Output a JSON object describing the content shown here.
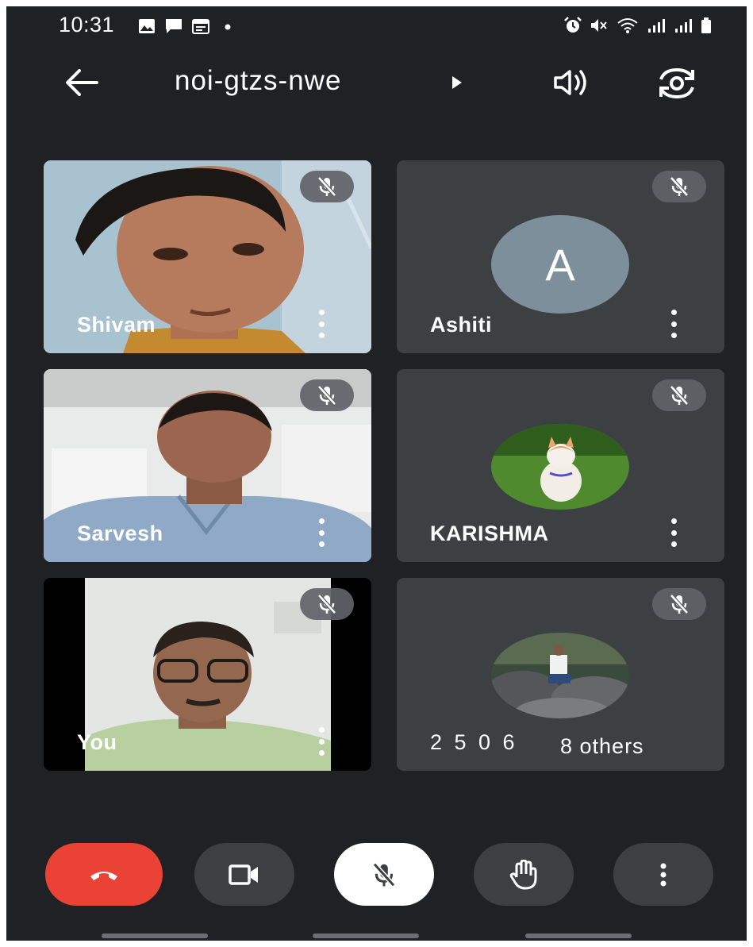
{
  "status_bar": {
    "time": "10:31",
    "left_icons": [
      "gallery-icon",
      "message-icon",
      "calendar-icon",
      "dot-icon"
    ],
    "right_icons": [
      "alarm-icon",
      "mute-icon",
      "wifi-icon",
      "signal-icon",
      "signal-icon",
      "battery-icon"
    ]
  },
  "top_bar": {
    "meeting_code": "noi-gtzs-nwe",
    "back_icon": "arrow-left-icon",
    "title_arrow_icon": "triangle-right-icon",
    "speaker_icon": "speaker-icon",
    "switch_camera_icon": "camera-flip-icon"
  },
  "participants": [
    {
      "name": "Shivam",
      "muted": true,
      "type": "video"
    },
    {
      "name": "Ashiti",
      "muted": true,
      "type": "avatar",
      "avatar_letter": "A"
    },
    {
      "name": "Sarvesh",
      "muted": true,
      "type": "video"
    },
    {
      "name": "KARISHMA",
      "muted": true,
      "type": "avatar-photo"
    },
    {
      "name": "You",
      "muted": true,
      "type": "video"
    },
    {
      "name": "2 5 0 6",
      "muted": true,
      "type": "avatar-photo",
      "overlay_label": "8 others"
    }
  ],
  "controls": {
    "end_call_icon": "phone-hangup-icon",
    "camera_icon": "video-camera-icon",
    "mic_icon": "mic-off-icon",
    "raise_hand_icon": "hand-icon",
    "more_icon": "more-vertical-icon"
  },
  "colors": {
    "background": "#202124",
    "tile": "#3c4043",
    "end_call": "#ea4335",
    "control": "#3c4043",
    "mic_active": "#ffffff",
    "avatar": "#7c8f9a"
  }
}
